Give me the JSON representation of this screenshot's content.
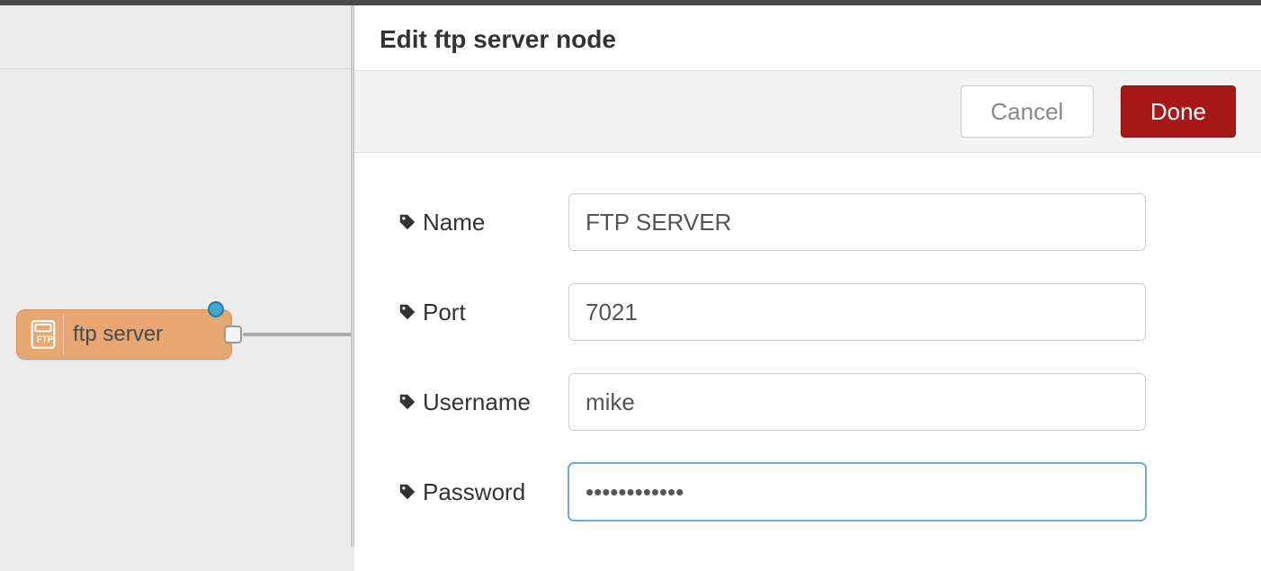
{
  "canvas": {
    "node": {
      "label": "ftp server"
    }
  },
  "panel": {
    "title": "Edit ftp server node",
    "toolbar": {
      "cancel_label": "Cancel",
      "done_label": "Done"
    },
    "form": {
      "name": {
        "label": "Name",
        "value": "FTP SERVER"
      },
      "port": {
        "label": "Port",
        "value": "7021"
      },
      "username": {
        "label": "Username",
        "value": "mike"
      },
      "password": {
        "label": "Password",
        "value": "••••••••••••"
      }
    }
  }
}
